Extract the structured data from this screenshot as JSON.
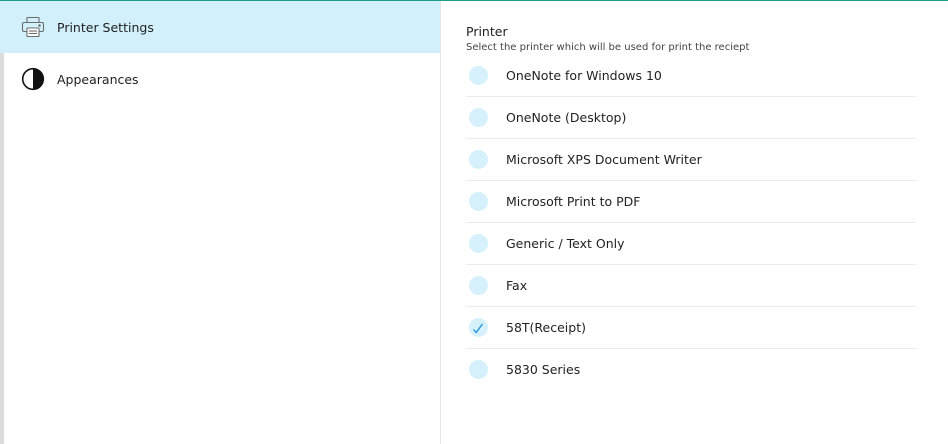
{
  "sidebar": {
    "items": [
      {
        "label": "Printer Settings",
        "icon": "printer-icon",
        "active": true
      },
      {
        "label": "Appearances",
        "icon": "contrast-icon",
        "active": false
      }
    ]
  },
  "main": {
    "title": "Printer",
    "subtitle": "Select the printer which will be used for print the reciept",
    "printers": [
      {
        "name": "OneNote for Windows 10",
        "selected": false
      },
      {
        "name": "OneNote (Desktop)",
        "selected": false
      },
      {
        "name": "Microsoft XPS Document Writer",
        "selected": false
      },
      {
        "name": "Microsoft Print to PDF",
        "selected": false
      },
      {
        "name": "Generic / Text Only",
        "selected": false
      },
      {
        "name": "Fax",
        "selected": false
      },
      {
        "name": "58T(Receipt)",
        "selected": true
      },
      {
        "name": "5830 Series",
        "selected": false
      }
    ]
  },
  "colors": {
    "accent_top": "#1a9e8a",
    "active_bg": "#d2f0fc",
    "radio_bg": "#d6f1fb",
    "check": "#1a8fd8"
  }
}
